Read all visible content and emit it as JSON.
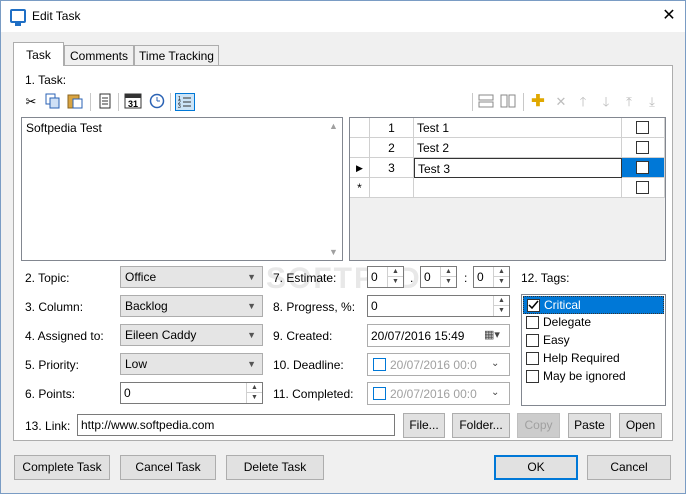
{
  "window": {
    "title": "Edit Task",
    "close_glyph": "✕"
  },
  "tabs": [
    "Task",
    "Comments",
    "Time Tracking"
  ],
  "labels": {
    "task": "1. Task:",
    "topic": "2. Topic:",
    "column": "3. Column:",
    "assigned": "4. Assigned to:",
    "priority": "5. Priority:",
    "points": "6. Points:",
    "estimate": "7. Estimate:",
    "progress": "8. Progress, %:",
    "created": "9. Created:",
    "deadline": "10. Deadline:",
    "completed": "11. Completed:",
    "tags": "12. Tags:",
    "link": "13. Link:"
  },
  "task_text": "Softpedia Test",
  "subtasks": [
    {
      "num": "1",
      "name": "Test 1",
      "marker": ""
    },
    {
      "num": "2",
      "name": "Test 2",
      "marker": ""
    },
    {
      "num": "3",
      "name": "Test 3",
      "marker": "▶"
    }
  ],
  "new_row_marker": "*",
  "fields": {
    "topic": "Office",
    "column": "Backlog",
    "assigned": "Eileen Caddy",
    "priority": "Low",
    "points": "0",
    "estimate": [
      "0",
      "0",
      "0"
    ],
    "estimate_sep": [
      ".",
      ":"
    ],
    "progress": "0",
    "created": "20/07/2016  15:49",
    "deadline": "20/07/2016  00:0",
    "completed": "20/07/2016  00:0",
    "link": "http://www.softpedia.com"
  },
  "tags": [
    {
      "label": "Critical",
      "checked": true,
      "selected": true
    },
    {
      "label": "Delegate",
      "checked": false
    },
    {
      "label": "Easy",
      "checked": false
    },
    {
      "label": "Help Required",
      "checked": false
    },
    {
      "label": "May be ignored",
      "checked": false
    }
  ],
  "link_buttons": {
    "file": "File...",
    "folder": "Folder...",
    "copy": "Copy",
    "paste": "Paste",
    "open": "Open"
  },
  "footer": {
    "complete": "Complete Task",
    "cancel_task": "Cancel Task",
    "delete": "Delete Task",
    "ok": "OK",
    "cancel": "Cancel"
  },
  "icons": {
    "cut": "scissors-icon",
    "copy": "copy-icon",
    "paste": "paste-icon",
    "doc": "document-icon",
    "calendar": "calendar-icon",
    "clock": "clock-icon",
    "list": "numbered-list-icon"
  },
  "colors": {
    "accent": "#0078d7",
    "watermark": "SOFTPEDIA"
  }
}
